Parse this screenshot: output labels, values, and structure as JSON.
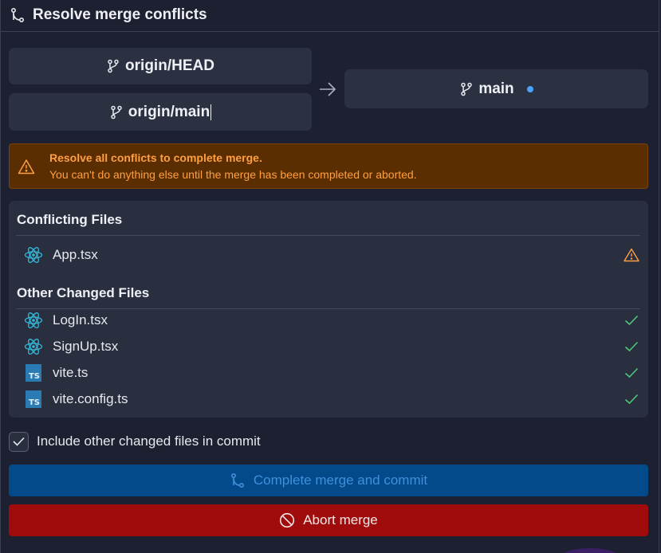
{
  "header": {
    "title": "Resolve merge conflicts",
    "icon": "git-merge-icon"
  },
  "branches": {
    "sources": [
      {
        "name": "origin/HEAD",
        "icon": "git-branch-icon"
      },
      {
        "name": "origin/main",
        "icon": "git-branch-icon"
      }
    ],
    "target": {
      "name": "main",
      "icon": "git-branch-icon",
      "status_color": "#4aa3ff"
    },
    "arrow_icon": "arrow-right-icon"
  },
  "alert": {
    "title": "Resolve all conflicts to complete merge.",
    "message": "You can't do anything else until the merge has been completed or aborted.",
    "icon": "warning-icon",
    "color": "#ff9f43"
  },
  "conflicting": {
    "title": "Conflicting Files",
    "files": [
      {
        "name": "App.tsx",
        "icon": "react-icon",
        "status": "warning"
      }
    ]
  },
  "other": {
    "title": "Other Changed Files",
    "files": [
      {
        "name": "LogIn.tsx",
        "icon": "react-icon",
        "status": "ok"
      },
      {
        "name": "SignUp.tsx",
        "icon": "react-icon",
        "status": "ok"
      },
      {
        "name": "vite.ts",
        "icon": "typescript-icon",
        "status": "ok"
      },
      {
        "name": "vite.config.ts",
        "icon": "typescript-icon",
        "status": "ok"
      }
    ]
  },
  "include_checkbox": {
    "label": "Include other changed files in commit",
    "checked": true
  },
  "buttons": {
    "complete": {
      "label": "Complete merge and commit",
      "icon": "git-merge-icon"
    },
    "abort": {
      "label": "Abort merge",
      "icon": "ban-icon"
    }
  },
  "colors": {
    "background": "#1c2030",
    "card": "#2c3142",
    "alert_bg": "#5a2e00",
    "success": "#4ec67a",
    "merge_button": "#024a8a",
    "abort_button": "#a00c0c"
  }
}
